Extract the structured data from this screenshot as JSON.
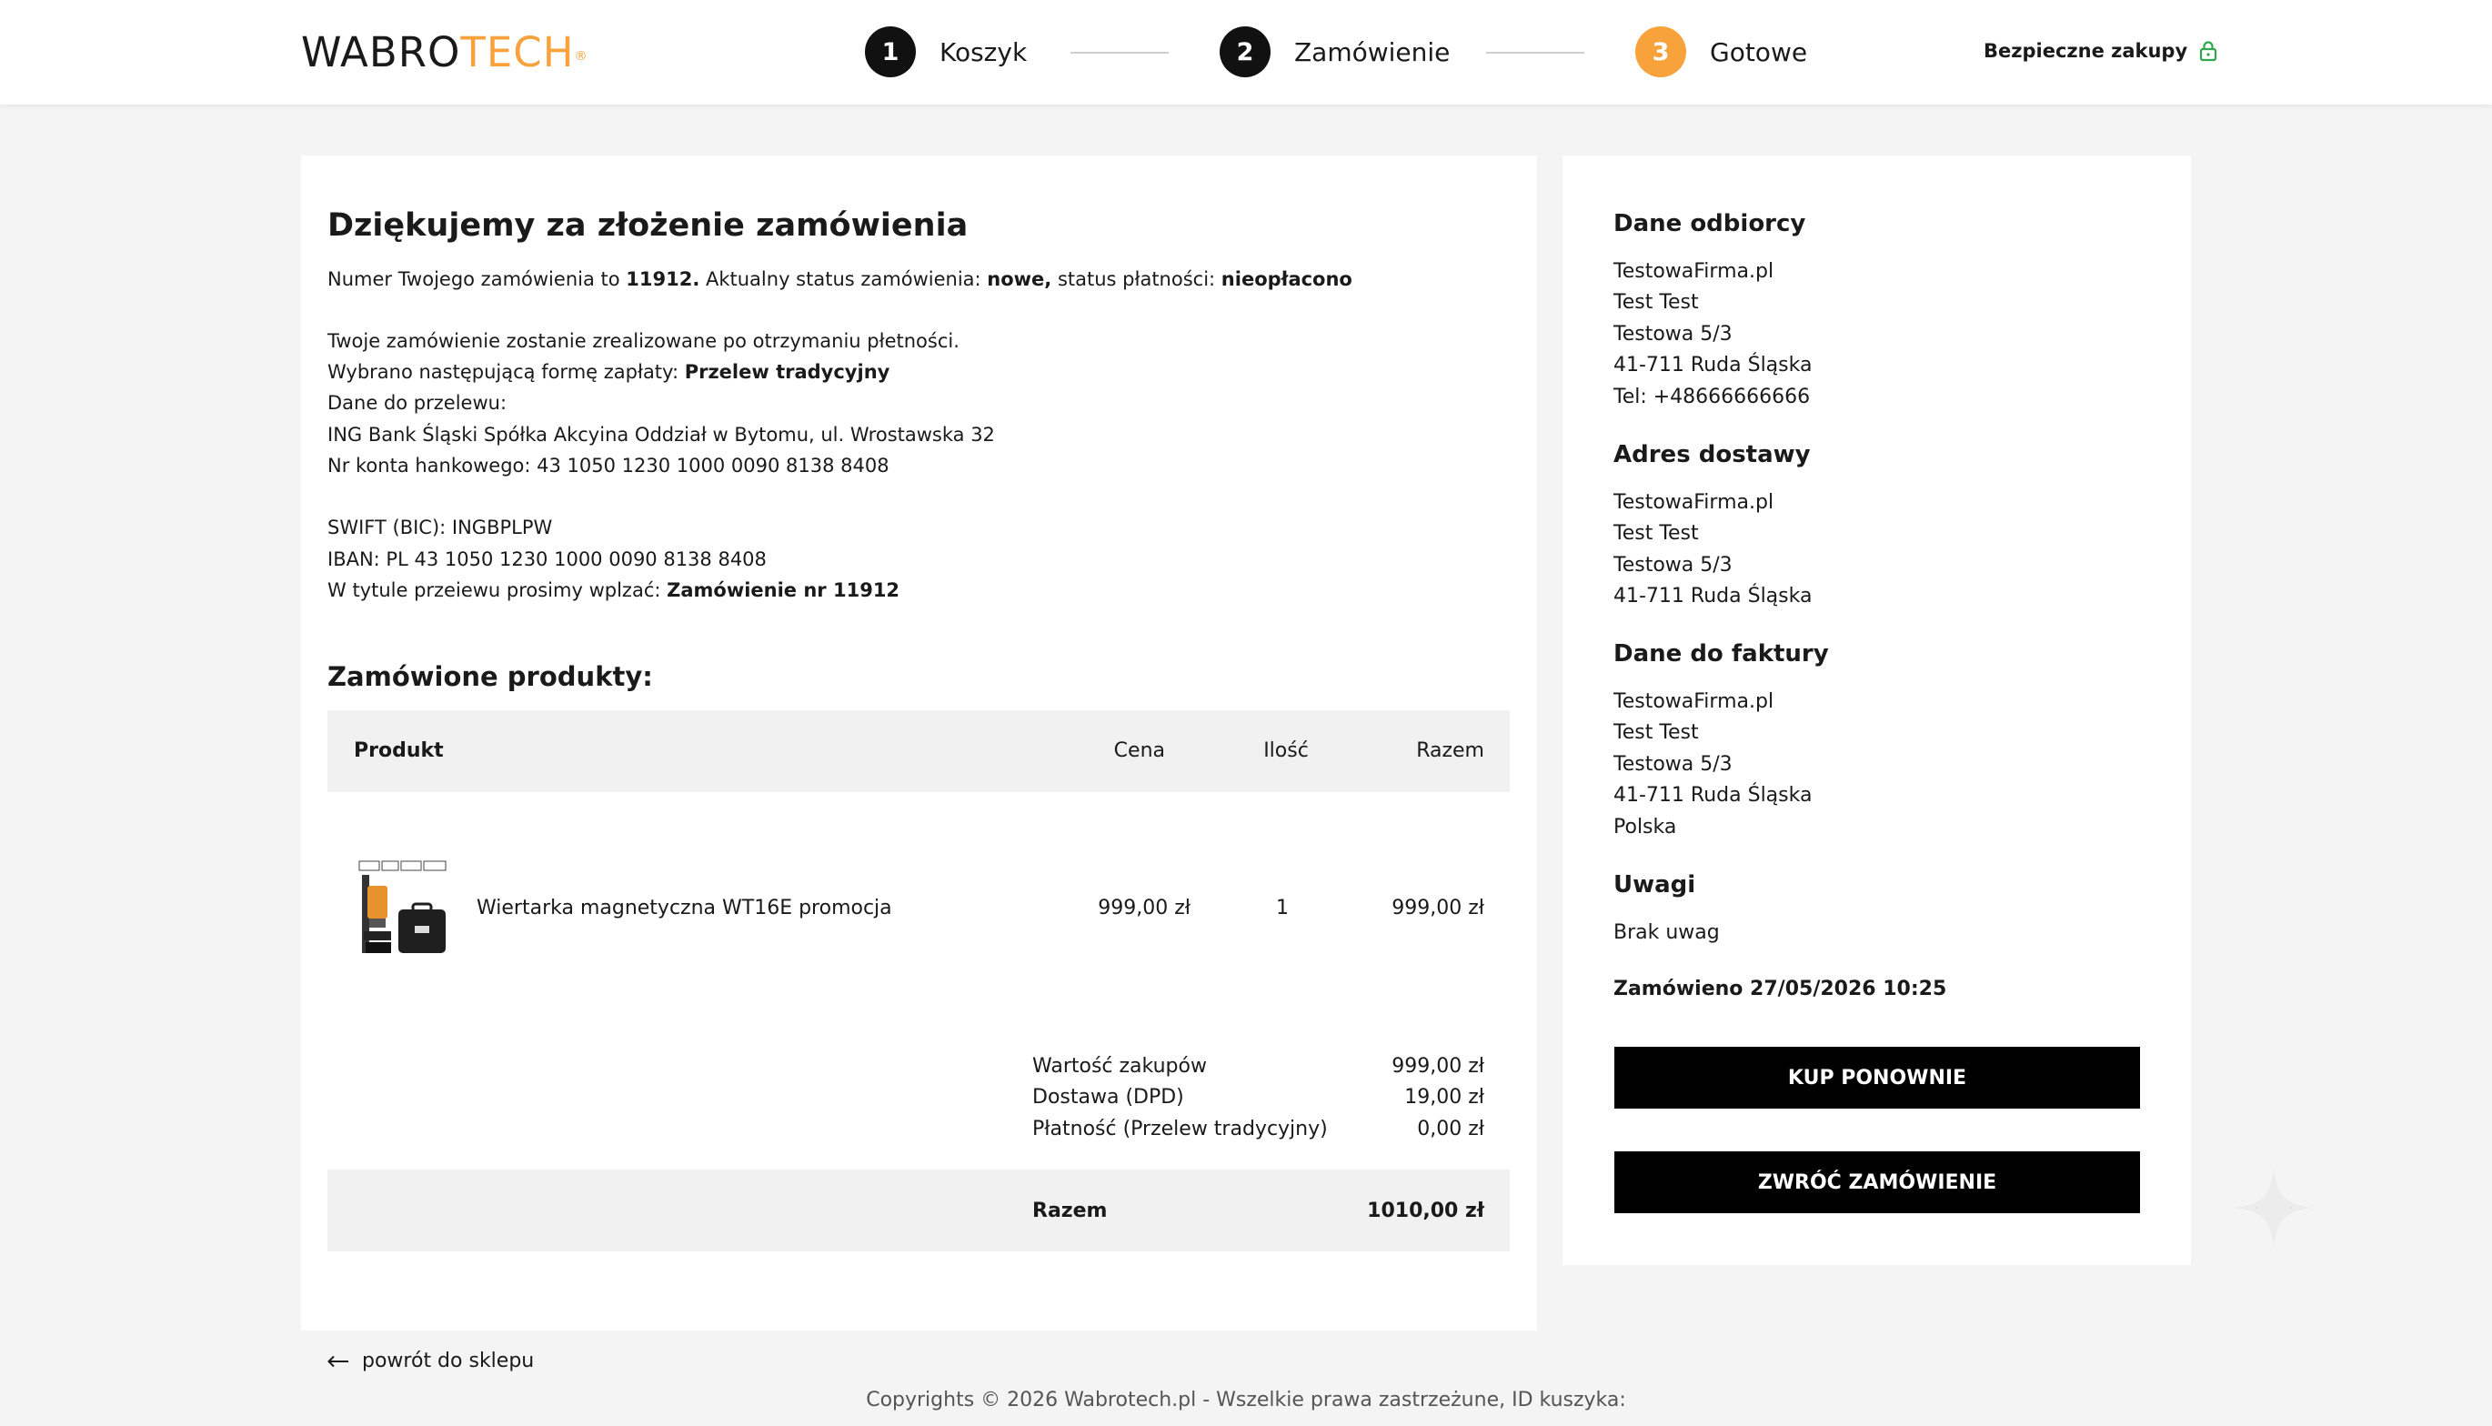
{
  "header": {
    "logo_main": "WABRO",
    "logo_accent": "TECH",
    "logo_mark": "®",
    "steps": [
      {
        "num": "1",
        "label": "Koszyk"
      },
      {
        "num": "2",
        "label": "Zamówienie"
      },
      {
        "num": "3",
        "label": "Gotowe"
      }
    ],
    "secure_label": "Bezpieczne zakupy",
    "secure_icon": "lock-icon",
    "accent_color": "#f7a23b"
  },
  "main": {
    "title": "Dziękujemy za złożenie zamówienia",
    "order_line": {
      "prefix": "Numer Twojego zamówienia to ",
      "order_no": "11912.",
      "mid": " Aktualny status zamówienia: ",
      "status": "nowe,",
      "pay_prefix": " status płatności: ",
      "pay_status": "nieopłacono"
    },
    "info1": "Twoje zamówienie zostanie zrealizowane po otrzymaniu płetności.",
    "payment_prefix": "Wybrano następującą formę zapłaty: ",
    "payment_method": "Przelew tradycyjny",
    "transfer_label": "Dane do przelewu:",
    "bank": "ING Bank Śląski Spółka Akcyina Oddział w Bytomu, ul. Wrostawska 32",
    "account": "Nr konta hankowego: 43 1050 1230 1000 0090 8138 8408",
    "swift": "SWIFT (BIC): INGBPLPW",
    "iban": "IBAN: PL 43 1050 1230 1000 0090 8138 8408",
    "title_prefix": "W tytule przeiewu prosimy wplzać: ",
    "title_value": "Zamówienie nr 11912",
    "products_heading": "Zamówione produkty:",
    "table": {
      "headers": {
        "product": "Produkt",
        "price": "Cena",
        "qty": "Ilość",
        "total": "Razem"
      },
      "rows": [
        {
          "name": "Wiertarka magnetyczna WT16E promocja",
          "price": "999,00 zł",
          "qty": "1",
          "total": "999,00 zł"
        }
      ]
    },
    "summary": [
      {
        "label": "Wartość zakupów",
        "value": "999,00 zł"
      },
      {
        "label": "Dostawa (DPD)",
        "value": "19,00 zł"
      },
      {
        "label": "Płatność (Przelew tradycyjny)",
        "value": "0,00 zł"
      }
    ],
    "grand_total": {
      "label": "Razem",
      "value": "1010,00 zł"
    }
  },
  "sidebar": {
    "recipient_title": "Dane odbiorcy",
    "recipient": [
      "TestowaFirma.pl",
      "Test Test",
      "Testowa 5/3",
      "41-711 Ruda Śląska",
      "Tel: +48666666666"
    ],
    "delivery_title": "Adres dostawy",
    "delivery": [
      "TestowaFirma.pl",
      "Test Test",
      "Testowa 5/3",
      "41-711 Ruda Śląska"
    ],
    "invoice_title": "Dane do faktury",
    "invoice": [
      "TestowaFirma.pl",
      "Test Test",
      "Testowa 5/3",
      "41-711 Ruda Śląska",
      "Polska"
    ],
    "notes_title": "Uwagi",
    "notes": "Brak uwag",
    "ordered": "Zamówieno 27/05/2026 10:25",
    "buy_again": "KUP PONOWNIE",
    "return_order": "ZWRÓĆ ZAMÓWIENIE"
  },
  "footer": {
    "back_label": "powrót do sklepu",
    "copyright": "Copyrights © 2026 Wabrotech.pl - Wszelkie prawa zastrzeżune, ID kuszyka:"
  }
}
